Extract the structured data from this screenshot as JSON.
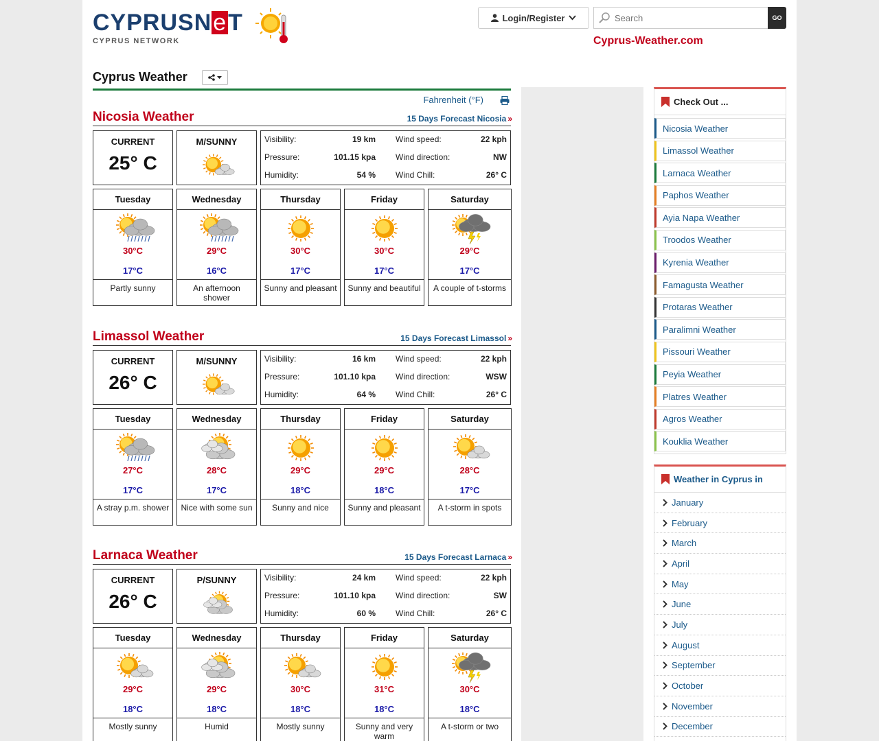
{
  "header": {
    "logo_text_pre": "CYPRUSN",
    "logo_text_e": "e",
    "logo_text_post": "T",
    "logo_sub": "CYPRUS NETWORK",
    "login_label": "Login/Register",
    "search_placeholder": "Search",
    "go_label": "GO",
    "site_link": "Cyprus-Weather.com"
  },
  "main": {
    "title": "Cyprus Weather",
    "unit_toggle": "Fahrenheit (°F)"
  },
  "cities": [
    {
      "name": "Nicosia Weather",
      "forecast_link": "15 Days Forecast Nicosia",
      "current_label": "CURRENT",
      "current_temp": "25° C",
      "condition": "M/SUNNY",
      "condition_icon": "mostly-sunny-icon",
      "details": [
        {
          "k1": "Visibility:",
          "v1": "19 km",
          "k2": "Wind speed:",
          "v2": "22 kph"
        },
        {
          "k1": "Pressure:",
          "v1": "101.15 kpa",
          "k2": "Wind direction:",
          "v2": "NW"
        },
        {
          "k1": "Humidity:",
          "v1": "54 %",
          "k2": "Wind Chill:",
          "v2": "26° C"
        }
      ],
      "days": [
        {
          "day": "Tuesday",
          "icon": "partly-sunny-showers-icon",
          "hi": "30°C",
          "lo": "17°C",
          "desc": "Partly sunny"
        },
        {
          "day": "Wednesday",
          "icon": "partly-sunny-showers-icon",
          "hi": "29°C",
          "lo": "16°C",
          "desc": "An afternoon shower"
        },
        {
          "day": "Thursday",
          "icon": "sunny-icon",
          "hi": "30°C",
          "lo": "17°C",
          "desc": "Sunny and pleasant"
        },
        {
          "day": "Friday",
          "icon": "sunny-icon",
          "hi": "30°C",
          "lo": "17°C",
          "desc": "Sunny and beautiful"
        },
        {
          "day": "Saturday",
          "icon": "thunderstorm-icon",
          "hi": "29°C",
          "lo": "17°C",
          "desc": "A couple of t-storms"
        }
      ]
    },
    {
      "name": "Limassol Weather",
      "forecast_link": "15 Days Forecast Limassol",
      "current_label": "CURRENT",
      "current_temp": "26° C",
      "condition": "M/SUNNY",
      "condition_icon": "mostly-sunny-icon",
      "details": [
        {
          "k1": "Visibility:",
          "v1": "16 km",
          "k2": "Wind speed:",
          "v2": "22 kph"
        },
        {
          "k1": "Pressure:",
          "v1": "101.10 kpa",
          "k2": "Wind direction:",
          "v2": "WSW"
        },
        {
          "k1": "Humidity:",
          "v1": "64 %",
          "k2": "Wind Chill:",
          "v2": "26° C"
        }
      ],
      "days": [
        {
          "day": "Tuesday",
          "icon": "partly-sunny-showers-icon",
          "hi": "27°C",
          "lo": "17°C",
          "desc": "A stray p.m. shower"
        },
        {
          "day": "Wednesday",
          "icon": "partly-cloudy-icon",
          "hi": "28°C",
          "lo": "17°C",
          "desc": "Nice with some sun"
        },
        {
          "day": "Thursday",
          "icon": "sunny-icon",
          "hi": "29°C",
          "lo": "18°C",
          "desc": "Sunny and nice"
        },
        {
          "day": "Friday",
          "icon": "sunny-icon",
          "hi": "29°C",
          "lo": "18°C",
          "desc": "Sunny and pleasant"
        },
        {
          "day": "Saturday",
          "icon": "mostly-sunny-icon",
          "hi": "28°C",
          "lo": "17°C",
          "desc": "A t-storm in spots"
        }
      ]
    },
    {
      "name": "Larnaca Weather",
      "forecast_link": "15 Days Forecast Larnaca",
      "current_label": "CURRENT",
      "current_temp": "26° C",
      "condition": "P/SUNNY",
      "condition_icon": "partly-cloudy-icon",
      "details": [
        {
          "k1": "Visibility:",
          "v1": "24 km",
          "k2": "Wind speed:",
          "v2": "22 kph"
        },
        {
          "k1": "Pressure:",
          "v1": "101.10 kpa",
          "k2": "Wind direction:",
          "v2": "SW"
        },
        {
          "k1": "Humidity:",
          "v1": "60 %",
          "k2": "Wind Chill:",
          "v2": "26° C"
        }
      ],
      "days": [
        {
          "day": "Tuesday",
          "icon": "mostly-sunny-icon",
          "hi": "29°C",
          "lo": "18°C",
          "desc": "Mostly sunny"
        },
        {
          "day": "Wednesday",
          "icon": "partly-cloudy-icon",
          "hi": "29°C",
          "lo": "18°C",
          "desc": "Humid"
        },
        {
          "day": "Thursday",
          "icon": "mostly-sunny-icon",
          "hi": "30°C",
          "lo": "18°C",
          "desc": "Mostly sunny"
        },
        {
          "day": "Friday",
          "icon": "sunny-icon",
          "hi": "31°C",
          "lo": "18°C",
          "desc": "Sunny and very warm"
        },
        {
          "day": "Saturday",
          "icon": "thunderstorm-icon",
          "hi": "30°C",
          "lo": "18°C",
          "desc": "A t-storm or two"
        }
      ]
    }
  ],
  "sidebar": {
    "checkout_title": "Check Out ...",
    "checkout_items": [
      {
        "label": "Nicosia Weather",
        "color": "#1b5a8a"
      },
      {
        "label": "Limassol Weather",
        "color": "#f0c419"
      },
      {
        "label": "Larnaca Weather",
        "color": "#1a7a3b"
      },
      {
        "label": "Paphos Weather",
        "color": "#e67e22"
      },
      {
        "label": "Ayia Napa Weather",
        "color": "#c0392b"
      },
      {
        "label": "Troodos Weather",
        "color": "#8bc34a"
      },
      {
        "label": "Kyrenia Weather",
        "color": "#6a1b6a"
      },
      {
        "label": "Famagusta Weather",
        "color": "#8b5a2b"
      },
      {
        "label": "Protaras Weather",
        "color": "#333333"
      },
      {
        "label": "Paralimni Weather",
        "color": "#1b5a8a"
      },
      {
        "label": "Pissouri Weather",
        "color": "#f0c419"
      },
      {
        "label": "Peyia Weather",
        "color": "#1a7a3b"
      },
      {
        "label": "Platres Weather",
        "color": "#e67e22"
      },
      {
        "label": "Agros Weather",
        "color": "#c0392b"
      },
      {
        "label": "Kouklia Weather",
        "color": "#8bc34a"
      }
    ],
    "months_title": "Weather in Cyprus in",
    "months": [
      "January",
      "February",
      "March",
      "April",
      "May",
      "June",
      "July",
      "August",
      "September",
      "October",
      "November",
      "December"
    ]
  },
  "colors": {
    "accent_red": "#c0001a",
    "accent_green": "#1a7a3b",
    "link_blue": "#1b5a8a"
  }
}
